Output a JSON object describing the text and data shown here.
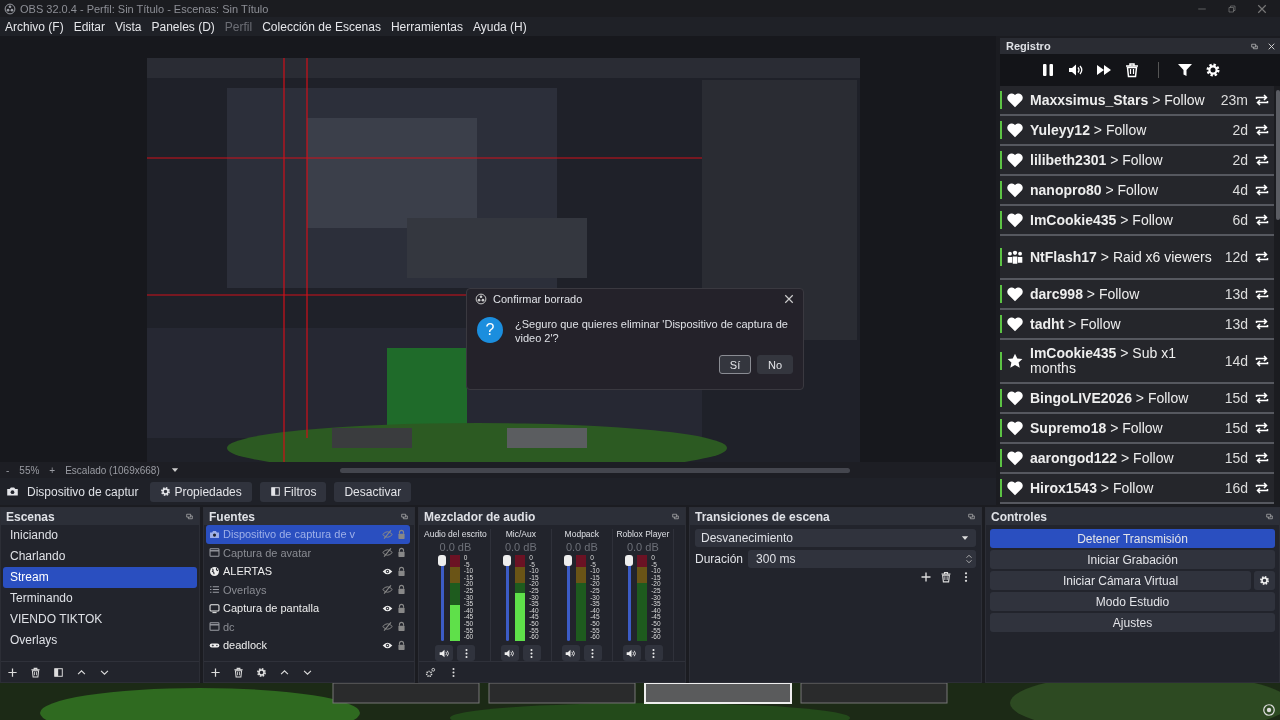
{
  "window": {
    "title": "OBS 32.0.4 - Perfil: Sin Título - Escenas: Sin Título"
  },
  "menu": [
    {
      "label": "Archivo (F)",
      "disabled": false
    },
    {
      "label": "Editar",
      "disabled": false
    },
    {
      "label": "Vista",
      "disabled": false
    },
    {
      "label": "Paneles (D)",
      "disabled": false
    },
    {
      "label": "Perfil",
      "disabled": true
    },
    {
      "label": "Colección de Escenas",
      "disabled": false
    },
    {
      "label": "Herramientas",
      "disabled": false
    },
    {
      "label": "Ayuda (H)",
      "disabled": false
    }
  ],
  "zoom_bar": {
    "minus": "-",
    "zoom": "55%",
    "plus": "+",
    "scale": "Escalado (1069x668)"
  },
  "source_toolbar": {
    "source": "Dispositivo de captur",
    "buttons": [
      {
        "label": "Propiedades",
        "kind": "gear"
      },
      {
        "label": "Filtros",
        "kind": "filter"
      },
      {
        "label": "Desactivar",
        "kind": "plain"
      }
    ]
  },
  "log_panel": {
    "title": "Registro",
    "events": [
      {
        "kind": "follow",
        "user": "Maxxsimus_Stars",
        "action": "> Follow",
        "time": "23m"
      },
      {
        "kind": "follow",
        "user": "Yuleyy12",
        "action": "> Follow",
        "time": "2d"
      },
      {
        "kind": "follow",
        "user": "lilibeth2301",
        "action": "> Follow",
        "time": "2d"
      },
      {
        "kind": "follow",
        "user": "nanopro80",
        "action": "> Follow",
        "time": "4d"
      },
      {
        "kind": "follow",
        "user": "ImCookie435",
        "action": "> Follow",
        "time": "6d"
      },
      {
        "kind": "raid",
        "user": "NtFlash17",
        "action": "> Raid x6 viewers",
        "time": "12d"
      },
      {
        "kind": "follow",
        "user": "darc998",
        "action": "> Follow",
        "time": "13d"
      },
      {
        "kind": "follow",
        "user": "tadht",
        "action": "> Follow",
        "time": "13d"
      },
      {
        "kind": "sub",
        "user": "ImCookie435",
        "action": "> Sub x1 months",
        "time": "14d"
      },
      {
        "kind": "follow",
        "user": "BingoLIVE2026",
        "action": "> Follow",
        "time": "15d"
      },
      {
        "kind": "follow",
        "user": "Supremo18",
        "action": "> Follow",
        "time": "15d"
      },
      {
        "kind": "follow",
        "user": "aarongod122",
        "action": "> Follow",
        "time": "15d"
      },
      {
        "kind": "follow",
        "user": "Hirox1543",
        "action": "> Follow",
        "time": "16d"
      }
    ]
  },
  "scenes": {
    "title": "Escenas",
    "items": [
      {
        "label": "Iniciando",
        "selected": false
      },
      {
        "label": "Charlando",
        "selected": false
      },
      {
        "label": "Stream",
        "selected": true
      },
      {
        "label": "Terminando",
        "selected": false
      },
      {
        "label": "VIENDO TIKTOK",
        "selected": false
      },
      {
        "label": "Overlays",
        "selected": false
      }
    ]
  },
  "sources": {
    "title": "Fuentes",
    "items": [
      {
        "label": "Dispositivo de captura de v",
        "kind": "camera",
        "visible": false,
        "selected": true
      },
      {
        "label": "Captura de avatar",
        "kind": "window",
        "visible": false,
        "selected": false
      },
      {
        "label": "ALERTAS",
        "kind": "globe",
        "visible": true,
        "selected": false
      },
      {
        "label": "Overlays",
        "kind": "list",
        "visible": false,
        "selected": false
      },
      {
        "label": "Captura de pantalla",
        "kind": "monitor",
        "visible": true,
        "selected": false
      },
      {
        "label": "dc",
        "kind": "window",
        "visible": false,
        "selected": false
      },
      {
        "label": "deadlock",
        "kind": "gamepad",
        "visible": true,
        "selected": false
      }
    ]
  },
  "mixer": {
    "title": "Mezclador de audio",
    "channels": [
      {
        "name": "Audio del escrito",
        "volume": "0.0 dB",
        "level": 1,
        "meter": {
          "level": 0.42
        },
        "scale": [
          "0",
          "-5",
          "-10",
          "-15",
          "-20",
          "-25",
          "-30",
          "-35",
          "-40",
          "-45",
          "-50",
          "-55",
          "-60"
        ]
      },
      {
        "name": "Mic/Aux",
        "volume": "0.0 dB",
        "level": 1,
        "meter": {
          "level": 0.56
        },
        "scale": [
          "0",
          "-5",
          "-10",
          "-15",
          "-20",
          "-25",
          "-30",
          "-35",
          "-40",
          "-45",
          "-50",
          "-55",
          "-60"
        ]
      },
      {
        "name": "Modpack",
        "volume": "0.0 dB",
        "level": 1,
        "meter": {
          "level": 0
        },
        "scale": [
          "0",
          "-5",
          "-10",
          "-15",
          "-20",
          "-25",
          "-30",
          "-35",
          "-40",
          "-45",
          "-50",
          "-55",
          "-60"
        ]
      },
      {
        "name": "Roblox Player",
        "volume": "0.0 dB",
        "level": 1,
        "meter": {
          "level": 0
        },
        "scale": [
          "0",
          "-5",
          "-10",
          "-15",
          "-20",
          "-25",
          "-30",
          "-35",
          "-40",
          "-45",
          "-50",
          "-55",
          "-60"
        ]
      }
    ]
  },
  "transitions": {
    "title": "Transiciones de escena",
    "selected": "Desvanecimiento",
    "duration_label": "Duración",
    "duration": "300 ms"
  },
  "controls": {
    "title": "Controles",
    "buttons": [
      {
        "label": "Detener Transmisión",
        "active": true,
        "settings": false
      },
      {
        "label": "Iniciar Grabación",
        "active": false,
        "settings": false
      },
      {
        "label": "Iniciar Cámara Virtual",
        "active": false,
        "settings": true
      },
      {
        "label": "Modo Estudio",
        "active": false,
        "settings": false
      },
      {
        "label": "Ajustes",
        "active": false,
        "settings": false
      }
    ]
  },
  "dialog": {
    "title": "Confirmar borrado",
    "icon_glyph": "?",
    "message": "¿Seguro que quieres eliminar 'Dispositivo de captura de video 2'?",
    "buttons": [
      {
        "label": "Sí",
        "focused": true
      },
      {
        "label": "No",
        "focused": false
      }
    ]
  }
}
